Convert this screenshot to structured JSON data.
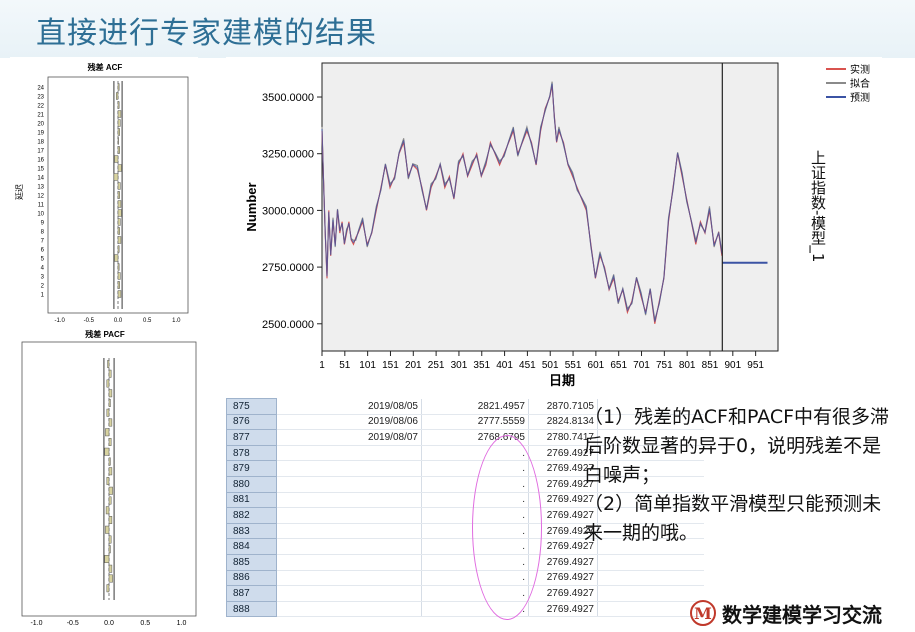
{
  "slide": {
    "title": "直接进行专家建模的结果"
  },
  "acf": {
    "title": "残差 ACF",
    "ylabel": "延迟",
    "lags": [
      "24",
      "23",
      "22",
      "21",
      "20",
      "19",
      "18",
      "17",
      "16",
      "15",
      "14",
      "13",
      "12",
      "11",
      "10",
      "9",
      "8",
      "7",
      "6",
      "5",
      "4",
      "3",
      "2",
      "1"
    ],
    "xticks": [
      "-1.0",
      "-0.5",
      "0.0",
      "0.5",
      "1.0"
    ],
    "values": [
      0.02,
      -0.03,
      0.02,
      0.05,
      0.04,
      0.03,
      0.01,
      0.03,
      -0.06,
      0.06,
      -0.07,
      0.04,
      0.03,
      0.05,
      0.06,
      0.04,
      0.03,
      0.05,
      0.02,
      -0.06,
      0.02,
      0.04,
      0.03,
      0.05
    ]
  },
  "pacf": {
    "title": "残差 PACF",
    "xticks": [
      "-1.0",
      "-0.5",
      "0.0",
      "0.5",
      "1.0"
    ],
    "values": [
      -0.02,
      0.03,
      -0.03,
      0.04,
      0.02,
      -0.03,
      0.04,
      -0.05,
      0.03,
      -0.06,
      0.02,
      0.04,
      -0.03,
      0.05,
      0.03,
      -0.04,
      0.04,
      -0.05,
      0.03,
      0.02,
      -0.06,
      0.04,
      0.05,
      -0.03
    ]
  },
  "chart_data": {
    "type": "line",
    "xlabel": "日期",
    "ylabel": "Number",
    "right_label": "上证指数-模型_1",
    "x_ticks": [
      "1",
      "51",
      "101",
      "151",
      "201",
      "251",
      "301",
      "351",
      "401",
      "451",
      "501",
      "551",
      "601",
      "651",
      "701",
      "751",
      "801",
      "851",
      "901",
      "951"
    ],
    "y_ticks": [
      "2500.0000",
      "2750.0000",
      "3000.0000",
      "3250.0000",
      "3500.0000"
    ],
    "xlim": [
      1,
      1000
    ],
    "ylim": [
      2380,
      3650
    ],
    "legend": [
      "实测",
      "拟合",
      "预测"
    ],
    "legend_position": "top-right",
    "forecast_start": 878,
    "actual": {
      "x": [
        1,
        5,
        8,
        12,
        16,
        20,
        25,
        30,
        35,
        40,
        45,
        50,
        55,
        60,
        65,
        70,
        75,
        80,
        90,
        100,
        110,
        120,
        130,
        140,
        150,
        160,
        170,
        180,
        190,
        200,
        210,
        220,
        230,
        240,
        250,
        260,
        270,
        280,
        290,
        300,
        310,
        320,
        330,
        340,
        350,
        360,
        370,
        380,
        390,
        400,
        410,
        420,
        430,
        440,
        450,
        460,
        470,
        480,
        490,
        500,
        505,
        510,
        515,
        520,
        530,
        540,
        550,
        560,
        570,
        580,
        590,
        600,
        610,
        620,
        630,
        640,
        650,
        660,
        670,
        680,
        690,
        700,
        710,
        720,
        730,
        740,
        750,
        760,
        770,
        780,
        790,
        800,
        810,
        820,
        830,
        840,
        850,
        860,
        870,
        877
      ],
      "y": [
        3350,
        3100,
        2900,
        2700,
        3000,
        2800,
        2950,
        2850,
        3000,
        2900,
        2950,
        2850,
        2900,
        2950,
        2870,
        2850,
        2880,
        2900,
        2950,
        2850,
        2900,
        3000,
        3100,
        3200,
        3100,
        3150,
        3250,
        3300,
        3150,
        3200,
        3180,
        3100,
        3000,
        3100,
        3150,
        3200,
        3100,
        3150,
        3050,
        3200,
        3250,
        3150,
        3200,
        3250,
        3150,
        3200,
        3300,
        3250,
        3200,
        3250,
        3300,
        3350,
        3250,
        3300,
        3350,
        3300,
        3200,
        3350,
        3450,
        3500,
        3550,
        3420,
        3300,
        3350,
        3300,
        3200,
        3150,
        3100,
        3050,
        3000,
        2850,
        2700,
        2800,
        2750,
        2650,
        2700,
        2600,
        2650,
        2550,
        2600,
        2700,
        2620,
        2550,
        2650,
        2500,
        2600,
        2700,
        2950,
        3100,
        3250,
        3150,
        3050,
        2950,
        2850,
        2950,
        2900,
        3000,
        2850,
        2900,
        2800
      ]
    },
    "forecast": {
      "x": [
        878,
        888,
        920,
        977
      ],
      "y": [
        2769.4927,
        2769.4927,
        2769.4927,
        2769.4927
      ]
    }
  },
  "table": {
    "rows": [
      {
        "id": "875",
        "date": "2019/08/05",
        "actual": "2821.4957",
        "fitted": "2870.7105"
      },
      {
        "id": "876",
        "date": "2019/08/06",
        "actual": "2777.5559",
        "fitted": "2824.8134"
      },
      {
        "id": "877",
        "date": "2019/08/07",
        "actual": "2768.6795",
        "fitted": "2780.7417"
      },
      {
        "id": "878",
        "date": "",
        "actual": ".",
        "fitted": "2769.4927"
      },
      {
        "id": "879",
        "date": "",
        "actual": ".",
        "fitted": "2769.4927"
      },
      {
        "id": "880",
        "date": "",
        "actual": ".",
        "fitted": "2769.4927"
      },
      {
        "id": "881",
        "date": "",
        "actual": ".",
        "fitted": "2769.4927"
      },
      {
        "id": "882",
        "date": "",
        "actual": ".",
        "fitted": "2769.4927"
      },
      {
        "id": "883",
        "date": "",
        "actual": ".",
        "fitted": "2769.4927"
      },
      {
        "id": "884",
        "date": "",
        "actual": ".",
        "fitted": "2769.4927"
      },
      {
        "id": "885",
        "date": "",
        "actual": ".",
        "fitted": "2769.4927"
      },
      {
        "id": "886",
        "date": "",
        "actual": ".",
        "fitted": "2769.4927"
      },
      {
        "id": "887",
        "date": "",
        "actual": ".",
        "fitted": "2769.4927"
      },
      {
        "id": "888",
        "date": "",
        "actual": ".",
        "fitted": "2769.4927"
      }
    ]
  },
  "notes": {
    "line1": "（1）残差的ACF和PACF中有很多滞后阶数显著的异于0，说明残差不是白噪声；",
    "line2": "（2）简单指数平滑模型只能预测未来一期的哦。"
  },
  "brand": {
    "mark": "M",
    "name": "数学建模学习交流"
  },
  "colors": {
    "actual": "#d9534f",
    "fitted": "#8a8a8a",
    "forecast": "#3b53a4",
    "bar": "#d8d3a0",
    "title": "#2e6f95"
  }
}
